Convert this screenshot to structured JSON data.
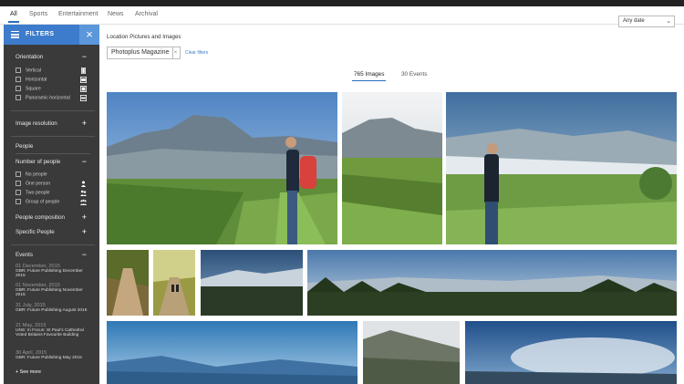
{
  "nav": {
    "tabs": [
      {
        "label": "All",
        "active": true
      },
      {
        "label": "Sports",
        "active": false
      },
      {
        "label": "Entertainment",
        "active": false
      },
      {
        "label": "News",
        "active": false
      },
      {
        "label": "Archival",
        "active": false
      }
    ],
    "date_filter": "Any date"
  },
  "sidebar": {
    "title": "FILTERS",
    "orientation": {
      "label": "Orientation",
      "toggle": "−",
      "options": [
        "Vertical",
        "Horizontal",
        "Square",
        "Panoramic horizontal"
      ]
    },
    "image_resolution": {
      "label": "Image resolution",
      "toggle": "+"
    },
    "people": {
      "heading": "People",
      "number_of_people": {
        "label": "Number of people",
        "toggle": "−",
        "options": [
          "No people",
          "One person",
          "Two people",
          "Group of people"
        ]
      },
      "composition": {
        "label": "People composition",
        "toggle": "+"
      },
      "specific": {
        "label": "Specific People",
        "toggle": "+"
      }
    },
    "events": {
      "label": "Events",
      "toggle": "−",
      "items": [
        {
          "date": "01 December, 2015",
          "title": "GBR: Future Publishing December 2015"
        },
        {
          "date": "01 November, 2015",
          "title": "GBR: Future Publishing November 2015"
        },
        {
          "date": "31 July, 2015",
          "title": "GBR: Future Publishing August 2015"
        },
        {
          "date": "21 May, 2015",
          "title": "UNS: In Focus: St Paul's Cathedral Voted Britains Favourite Building"
        },
        {
          "date": "30 April, 2015",
          "title": "GBR: Future Publishing May 2015"
        }
      ],
      "see_more": "+ See more"
    }
  },
  "main": {
    "breadcrumb": "Location Pictures and Images",
    "search_tag": "Photoplus Magazine",
    "tag_remove": "×",
    "clear_filters": "Clear filters",
    "result_tabs": [
      {
        "label": "765 Images",
        "active": true
      },
      {
        "label": "30 Events",
        "active": false
      }
    ]
  },
  "colors": {
    "accent": "#3d7ccc",
    "sidebar_bg": "#3a3a3a",
    "topbar": "#222222"
  }
}
